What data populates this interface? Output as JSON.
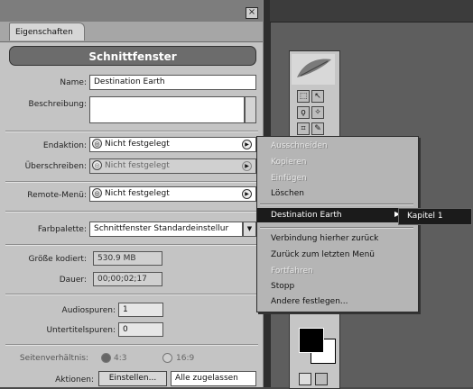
{
  "panel": {
    "tab_label": "Eigenschaften",
    "close_glyph": "×",
    "title": "Schnittfenster",
    "name_label": "Name:",
    "name_value": "Destination Earth",
    "description_label": "Beschreibung:",
    "description_value": "",
    "end_action_label": "Endaktion:",
    "end_action_value": "Nicht festgelegt",
    "override_label": "Überschreiben:",
    "override_value": "Nicht festgelegt",
    "remote_menu_label": "Remote-Menü:",
    "remote_menu_value": "Nicht festgelegt",
    "palette_label": "Farbpalette:",
    "palette_value": "Schnittfenster Standardeinstellur",
    "encoded_size_label": "Größe kodiert:",
    "encoded_size_value": "530.9 MB",
    "duration_label": "Dauer:",
    "duration_value": "00;00;02;17",
    "audio_tracks_label": "Audiospuren:",
    "audio_tracks_value": "1",
    "subtitle_tracks_label": "Untertitelspuren:",
    "subtitle_tracks_value": "0",
    "aspect_ratio_label": "Seitenverhältnis:",
    "aspect_43": "4:3",
    "aspect_169": "16:9",
    "actions_label": "Aktionen:",
    "actions_button": "Einstellen...",
    "actions_value": "Alle zugelassen"
  },
  "context_menu": {
    "items": [
      {
        "label": "Ausschneiden",
        "enabled": false
      },
      {
        "label": "Kopieren",
        "enabled": false
      },
      {
        "label": "Einfügen",
        "enabled": false
      },
      {
        "label": "Löschen",
        "enabled": true
      },
      {
        "label": "Destination Earth",
        "enabled": true,
        "highlighted": true
      },
      {
        "label": "Verbindung hierher zurück",
        "enabled": true
      },
      {
        "label": "Zurück zum letzten Menü",
        "enabled": true
      },
      {
        "label": "Fortfahren",
        "enabled": false
      },
      {
        "label": "Stopp",
        "enabled": true
      },
      {
        "label": "Andere festlegen...",
        "enabled": true
      }
    ],
    "submenu_item": "Kapitel 1"
  },
  "colors": {
    "panel_bg": "#c4c4c4",
    "menu_highlight": "#1b1b1b",
    "workspace_bg": "#5e5e5e"
  }
}
